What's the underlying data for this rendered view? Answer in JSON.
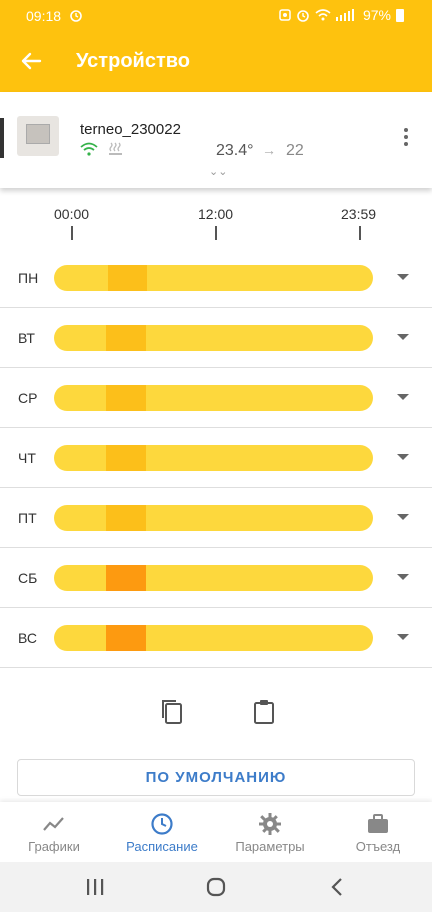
{
  "status_bar": {
    "time": "09:18",
    "battery": "97%"
  },
  "app_bar": {
    "title": "Устройство",
    "back_icon": "arrow-left-icon"
  },
  "device": {
    "name": "terneo_230022",
    "current_temp": "23.4°",
    "arrow": "→",
    "target_temp": "22",
    "expand": "⌄⌄"
  },
  "timeline": {
    "start": "00:00",
    "mid": "12:00",
    "end": "23:59"
  },
  "days": [
    {
      "label": "ПН",
      "segments": [
        {
          "start": 0.168,
          "end": 0.293,
          "color": "#fcbf1a"
        }
      ]
    },
    {
      "label": "ВТ",
      "segments": [
        {
          "start": 0.163,
          "end": 0.288,
          "color": "#fcbf1a"
        }
      ]
    },
    {
      "label": "СР",
      "segments": [
        {
          "start": 0.163,
          "end": 0.288,
          "color": "#fcbf1a"
        }
      ]
    },
    {
      "label": "ЧТ",
      "segments": [
        {
          "start": 0.163,
          "end": 0.288,
          "color": "#fcbf1a"
        }
      ]
    },
    {
      "label": "ПТ",
      "segments": [
        {
          "start": 0.163,
          "end": 0.288,
          "color": "#fcbf1a"
        }
      ]
    },
    {
      "label": "СБ",
      "segments": [
        {
          "start": 0.163,
          "end": 0.288,
          "color": "#fd9a10"
        }
      ]
    },
    {
      "label": "ВС",
      "segments": [
        {
          "start": 0.163,
          "end": 0.288,
          "color": "#fd9a10"
        }
      ]
    }
  ],
  "tools": {
    "copy_icon": "copy-icon",
    "paste_icon": "clipboard-icon"
  },
  "default_button": {
    "label": "ПО УМОЛЧАНИЮ"
  },
  "bottom_nav": [
    {
      "label": "Графики",
      "icon": "chart-line-icon",
      "active": false
    },
    {
      "label": "Расписание",
      "icon": "clock-icon",
      "active": true
    },
    {
      "label": "Параметры",
      "icon": "gear-icon",
      "active": false
    },
    {
      "label": "Отъезд",
      "icon": "briefcase-icon",
      "active": false
    }
  ],
  "colors": {
    "accent": "#fec20e",
    "bar": "#fdd83d",
    "active_nav": "#3d7cc9"
  }
}
